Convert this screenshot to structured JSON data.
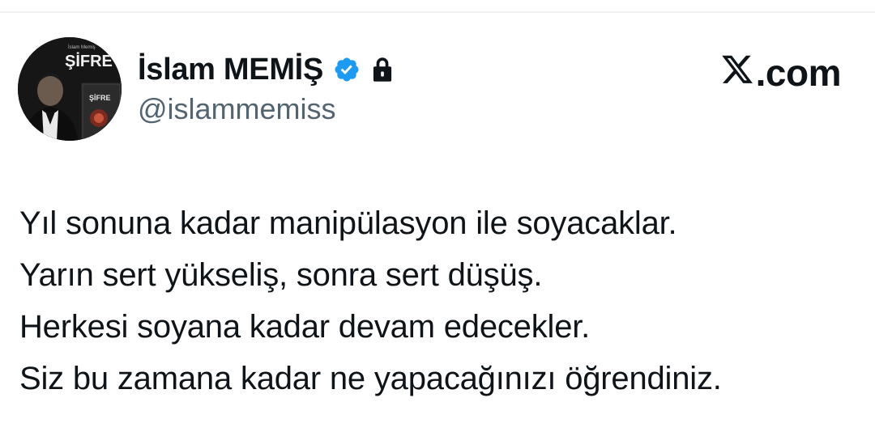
{
  "profile": {
    "display_name": "İslam MEMİŞ",
    "handle": "@islammemiss",
    "verified": true,
    "protected": true,
    "avatar": {
      "book_title": "ŞİFRE",
      "book_author": "İslam Memiş"
    }
  },
  "brand": {
    "label": ".com",
    "logo_icon": "x-logo-icon"
  },
  "tweet": {
    "lines": [
      "Yıl sonuna kadar manipülasyon ile soyacaklar.",
      "Yarın sert yükseliş, sonra sert düşüş.",
      "Herkesi soyana kadar devam edecekler.",
      "Siz bu zamana kadar ne yapacağınızı öğrendiniz."
    ]
  },
  "colors": {
    "text": "#0f1419",
    "secondary_text": "#536471",
    "verified_badge": "#1d9bf0",
    "background": "#ffffff"
  }
}
